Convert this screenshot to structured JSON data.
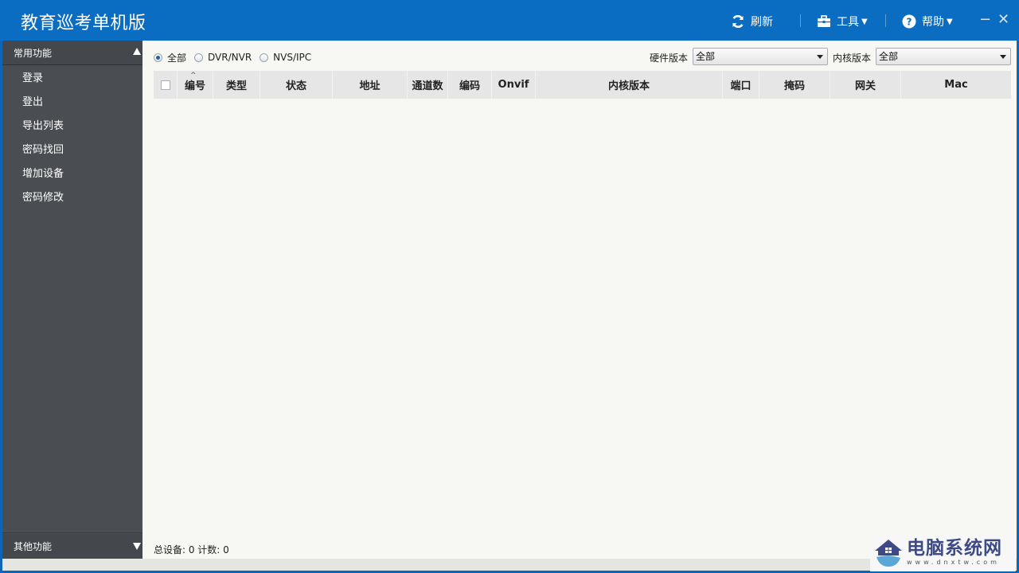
{
  "app": {
    "title": "教育巡考单机版"
  },
  "toolbar": {
    "refresh_label": "刷新",
    "tools_label": "工具",
    "help_label": "帮助",
    "minimize_glyph": "−",
    "close_glyph": "✕"
  },
  "sidebar": {
    "common_header": "常用功能",
    "items": [
      {
        "label": "登录"
      },
      {
        "label": "登出"
      },
      {
        "label": "导出列表"
      },
      {
        "label": "密码找回"
      },
      {
        "label": "增加设备"
      },
      {
        "label": "密码修改"
      }
    ],
    "other_header": "其他功能"
  },
  "filters": {
    "radios": [
      {
        "label": "全部",
        "selected": true
      },
      {
        "label": "DVR/NVR",
        "selected": false
      },
      {
        "label": "NVS/IPC",
        "selected": false
      }
    ],
    "hardware_version_label": "硬件版本",
    "hardware_version_value": "全部",
    "kernel_version_label": "内核版本",
    "kernel_version_value": "全部"
  },
  "table": {
    "columns": [
      "编号",
      "类型",
      "状态",
      "地址",
      "通道数",
      "编码",
      "Onvif",
      "内核版本",
      "端口",
      "掩码",
      "网关",
      "Mac"
    ],
    "sort_glyph": "^",
    "rows": []
  },
  "status": {
    "text": "总设备: 0  计数: 0"
  },
  "watermark": {
    "main": "电脑系统网",
    "sub": "www.dnxtw.com"
  },
  "colors": {
    "titlebar": "#0a6dc2",
    "sidebar": "#4a4d52",
    "content_bg": "#f7f7f4",
    "header_bg": "#e6e6e6"
  }
}
